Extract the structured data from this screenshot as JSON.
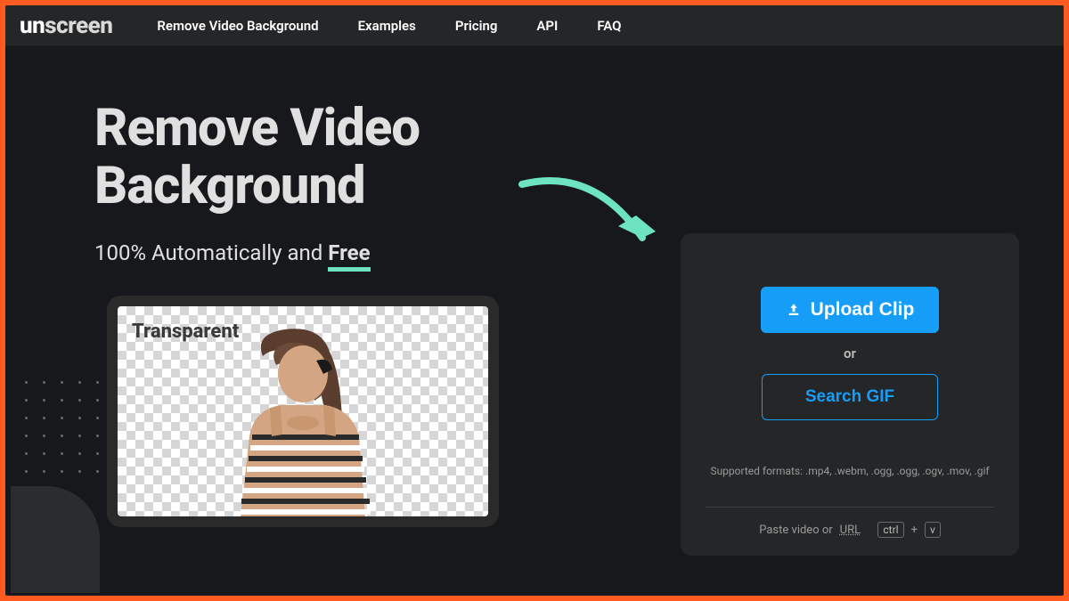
{
  "brand": {
    "prefix": "un",
    "suffix": "screen"
  },
  "nav": {
    "items": [
      "Remove Video Background",
      "Examples",
      "Pricing",
      "API",
      "FAQ"
    ]
  },
  "hero": {
    "headline_line1": "Remove Video",
    "headline_line2": "Background",
    "subhead_prefix": "100% Automatically and ",
    "subhead_free": "Free",
    "transparent_label": "Transparent"
  },
  "upload": {
    "button_label": "Upload Clip",
    "or_label": "or",
    "search_gif_label": "Search GIF",
    "formats_text": "Supported formats: .mp4, .webm, .ogg, .ogg, .ogv, .mov, .gif",
    "paste_prefix": "Paste video or ",
    "paste_url": "URL",
    "kbd_ctrl": "ctrl",
    "kbd_plus": "+",
    "kbd_v": "v"
  }
}
